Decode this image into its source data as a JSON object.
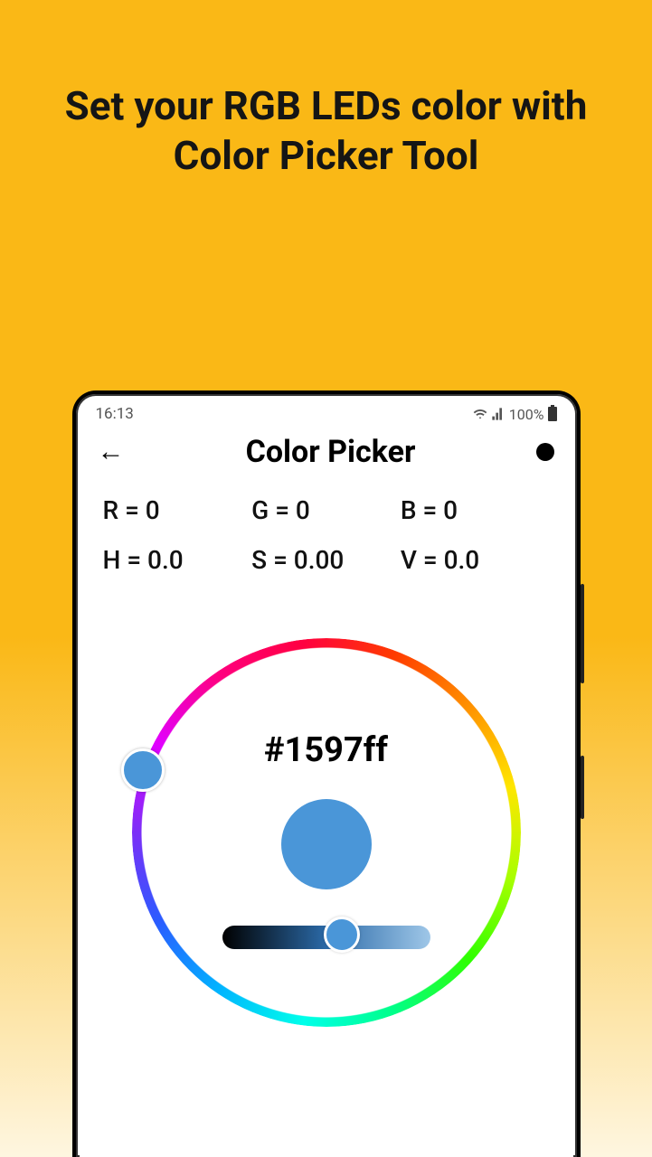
{
  "promo": {
    "headline": "Set your RGB LEDs color with Color Picker Tool"
  },
  "status": {
    "time": "16:13",
    "battery": "100%"
  },
  "header": {
    "title": "Color Picker"
  },
  "rgb": {
    "r": "R = 0",
    "g": "G = 0",
    "b": "B = 0"
  },
  "hsv": {
    "h": "H = 0.0",
    "s": "S = 0.00",
    "v": "V = 0.0"
  },
  "picker": {
    "hex": "#1597ff",
    "swatch_color": "#4a96d8"
  }
}
